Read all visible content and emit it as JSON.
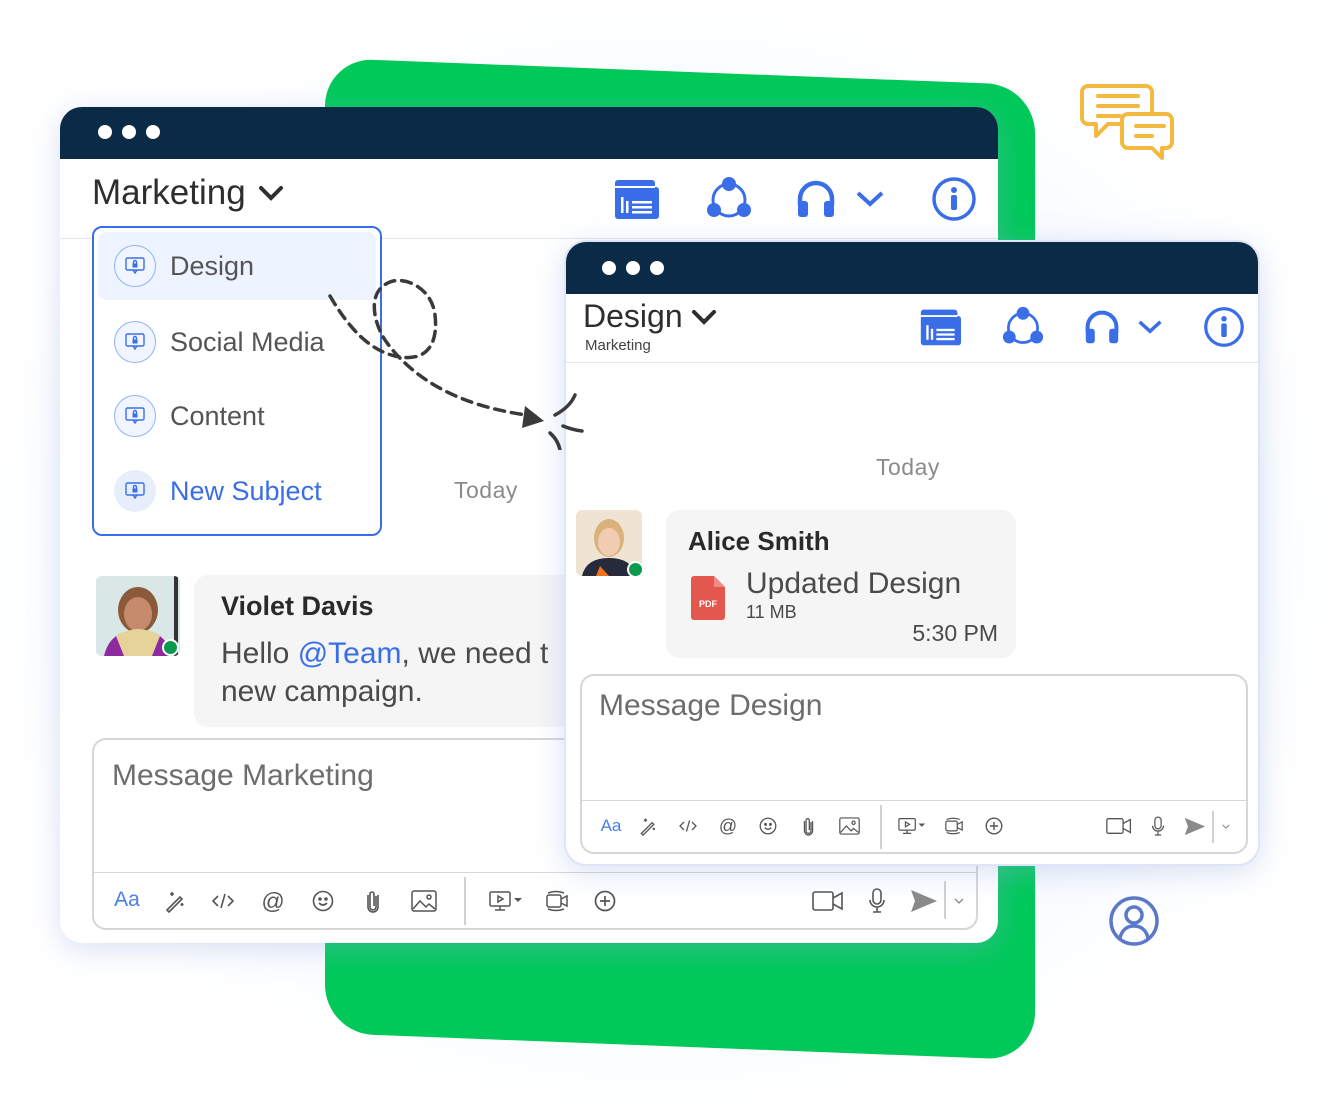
{
  "colors": {
    "brand_green": "#00c95a",
    "titlebar_navy": "#0b2a45",
    "accent_blue": "#3a6ee8",
    "presence_green": "#0a9a4b",
    "pdf_red": "#e4574f",
    "decor_yellow": "#f4b940",
    "decor_avatar_blue": "#5b78c9"
  },
  "main_window": {
    "channel_title": "Marketing",
    "header_icons": [
      "folder-files-icon",
      "share-network-icon",
      "headset-icon",
      "chevron-down-icon",
      "info-icon"
    ],
    "channel_dropdown": {
      "items": [
        {
          "label": "Design",
          "icon": "chat-lock-icon",
          "selected": true
        },
        {
          "label": "Social Media",
          "icon": "chat-lock-icon",
          "selected": false
        },
        {
          "label": "Content",
          "icon": "chat-lock-icon",
          "selected": false
        },
        {
          "label": "New Subject",
          "icon": "chat-lock-icon",
          "selected": false,
          "is_action": true
        }
      ]
    },
    "date_divider": "Today",
    "messages": [
      {
        "sender": "Violet Davis",
        "text_before_mention": "Hello ",
        "mention": "@Team",
        "text_after_mention_line1": ", we need t",
        "text_line2": "new campaign.",
        "online": true
      }
    ],
    "composer": {
      "placeholder": "Message Marketing",
      "toolbar_left": [
        "Aa",
        "magic-wand-icon",
        "code-icon",
        "at-icon",
        "emoji-icon",
        "paperclip-icon",
        "image-icon"
      ],
      "toolbar_middle": [
        "screen-share-icon",
        "video-call-icon",
        "add-circle-icon"
      ],
      "toolbar_right": [
        "video-camera-icon",
        "microphone-icon",
        "send-icon",
        "chevron-down-icon"
      ],
      "format_label": "Aa"
    }
  },
  "sub_window": {
    "channel_title": "Design",
    "parent_channel": "Marketing",
    "header_icons": [
      "folder-files-icon",
      "share-network-icon",
      "headset-icon",
      "chevron-down-icon",
      "info-icon"
    ],
    "date_divider": "Today",
    "messages": [
      {
        "sender": "Alice Smith",
        "attachment": {
          "type": "PDF",
          "name": "Updated Design",
          "size": "11 MB"
        },
        "time": "5:30 PM",
        "online": true
      }
    ],
    "composer": {
      "placeholder": "Message Design",
      "format_label": "Aa"
    }
  },
  "decorations": [
    "chat-bubbles-icon",
    "user-profile-icon",
    "dashed-arrow"
  ]
}
